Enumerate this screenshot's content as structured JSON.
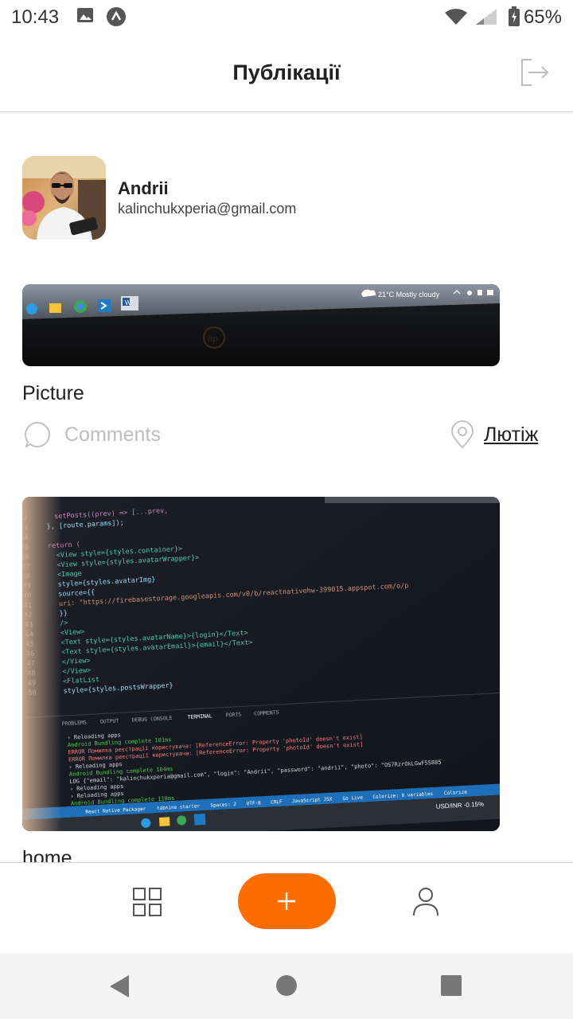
{
  "status_bar": {
    "time": "10:43",
    "battery_percent": "65%",
    "icons": [
      "image-icon",
      "app-notification-icon",
      "wifi-icon",
      "signal-icon",
      "battery-icon"
    ]
  },
  "header": {
    "title": "Публікації",
    "logout_icon": "logout-icon"
  },
  "profile": {
    "name": "Andrii",
    "email": "kalinchukxperia@gmail.com"
  },
  "posts": [
    {
      "title": "Picture",
      "comments_label": "Comments",
      "location": "Лютіж",
      "image_caption": {
        "weather": "21°C  Mostly cloudy"
      }
    },
    {
      "title": "home",
      "code_lines": [
        "  setPosts((prev) => [...prev,",
        "}, [route.params]);",
        "",
        "return (",
        "  <View style={styles.container}>",
        "    <View style={styles.avatarWrapper}>",
        "      <Image",
        "        style={styles.avatarImg}",
        "        source={{",
        "          uri: \"https://firebasestorage.googleapis.com/v0/b/reactnativehw-399015.appspot.com/o/p",
        "        }}",
        "      />",
        "      <View>",
        "        <Text style={styles.avatarName}>{login}</Text>",
        "        <Text style={styles.avatarEmail}>{email}</Text>",
        "      </View>",
        "    </View>",
        "    <FlatList",
        "      style={styles.postsWrapper}"
      ],
      "line_numbers": [
        "32",
        "33",
        "34",
        "35",
        "36",
        "37",
        "38",
        "39",
        "40",
        "41",
        "42",
        "43",
        "44",
        "45",
        "46",
        "47",
        "48",
        "49",
        "50"
      ],
      "terminal_tabs": [
        "PROBLEMS",
        "OUTPUT",
        "DEBUG CONSOLE",
        "TERMINAL",
        "PORTS",
        "COMMENTS"
      ],
      "terminal_lines": [
        "› Reloading apps",
        "Android Bundling complete 101ms",
        "ERROR  Помилка реєстрації користувача:  [ReferenceError: Property 'photoId' doesn't exist]",
        "ERROR  Помилка реєстрації користувача:  [ReferenceError: Property 'photoId' doesn't exist]",
        "› Reloading apps",
        "Android Bundling complete 104ms",
        "LOG  {\"email\": \"kalinchukxperia@gmail.com\", \"login\": \"Andrii\", \"password\": \"andrii\", \"photo\": \"OS7RzrOkLGwFSS885",
        "› Reloading apps",
        "› Reloading apps",
        "Android Bundling complete 118ms"
      ],
      "status_items": [
        "React Native Packager",
        "tabnine starter",
        "Spaces: 2",
        "UTF-8",
        "CRLF",
        "JavaScript JSX",
        "Go Live",
        "Colorize: 0 variables",
        "Colorize"
      ],
      "taskbar_text": "USD/INR  -0.15%"
    }
  ],
  "tab_bar": {
    "items": [
      "grid-icon",
      "plus-icon",
      "user-icon"
    ],
    "accent_color": "#ff6c00"
  },
  "nav_bar": {
    "items": [
      "back-icon",
      "home-icon",
      "recents-icon"
    ]
  }
}
